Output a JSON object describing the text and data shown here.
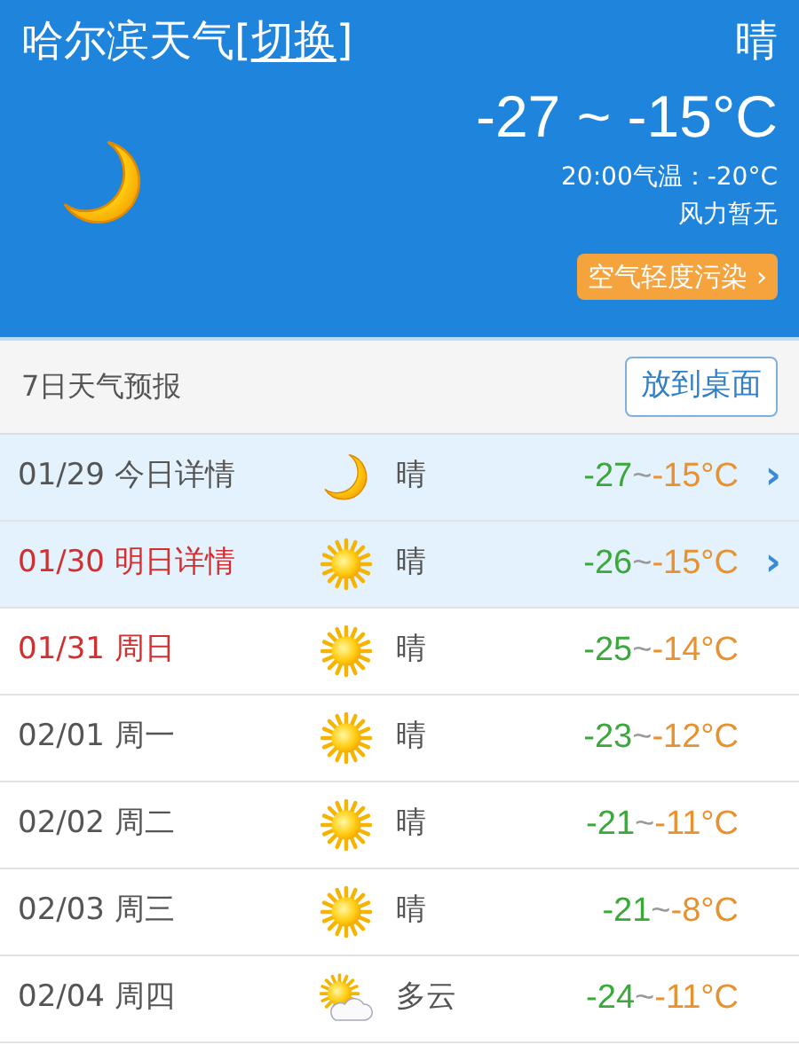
{
  "header": {
    "city_title": "哈尔滨天气",
    "switch_link": {
      "open": "[",
      "label": "切换",
      "close": "]"
    },
    "condition": "晴",
    "kind": "moon",
    "temp_range": "-27 ~ -15°C",
    "current_temp": "20:00气温：-20°C",
    "wind": "风力暂无",
    "air_quality_button": "空气轻度污染",
    "air_quality_chevron": "›"
  },
  "forecast": {
    "title": "7日天气预报",
    "desktop_button": "放到桌面",
    "days": [
      {
        "date": "01/29 今日详情",
        "kind": "moon",
        "condition": "晴",
        "low": "-27",
        "sep": "~",
        "high": "-15°C",
        "detail": true,
        "highlight": false,
        "chevron": "›"
      },
      {
        "date": "01/30 明日详情",
        "kind": "sun",
        "condition": "晴",
        "low": "-26",
        "sep": "~",
        "high": "-15°C",
        "detail": true,
        "highlight": true,
        "chevron": "›"
      },
      {
        "date": "01/31 周日",
        "kind": "sun",
        "condition": "晴",
        "low": "-25",
        "sep": "~",
        "high": "-14°C",
        "detail": false,
        "highlight": true
      },
      {
        "date": "02/01 周一",
        "kind": "sun",
        "condition": "晴",
        "low": "-23",
        "sep": "~",
        "high": "-12°C",
        "detail": false,
        "highlight": false
      },
      {
        "date": "02/02 周二",
        "kind": "sun",
        "condition": "晴",
        "low": "-21",
        "sep": "~",
        "high": "-11°C",
        "detail": false,
        "highlight": false
      },
      {
        "date": "02/03 周三",
        "kind": "sun",
        "condition": "晴",
        "low": "-21",
        "sep": "~",
        "high": "-8°C",
        "detail": false,
        "highlight": false
      },
      {
        "date": "02/04 周四",
        "kind": "partly_cloudy",
        "condition": "多云",
        "low": "-24",
        "sep": "~",
        "high": "-11°C",
        "detail": false,
        "highlight": false
      }
    ]
  }
}
